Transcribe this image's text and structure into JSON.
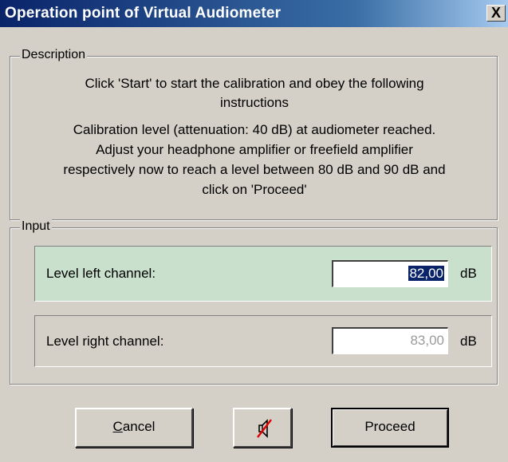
{
  "window": {
    "title": "Operation point of Virtual Audiometer",
    "close_label": "X"
  },
  "description": {
    "legend": "Description",
    "lines": [
      "Click 'Start' to start the calibration and obey the following",
      "instructions",
      "Calibration level (attenuation: 40 dB) at audiometer reached.",
      "Adjust your headphone amplifier or freefield amplifier",
      "respectively now to reach a level between 80 dB and 90 dB and",
      "click on 'Proceed'"
    ]
  },
  "input": {
    "legend": "Input",
    "left": {
      "label": "Level left channel:",
      "value": "82,00",
      "unit": "dB",
      "selected": true
    },
    "right": {
      "label": "Level right channel:",
      "value": "83,00",
      "unit": "dB",
      "disabled": true
    }
  },
  "buttons": {
    "cancel": {
      "mnemonic": "C",
      "rest": "ancel"
    },
    "mute_icon": "speaker-muted-icon",
    "proceed": "Proceed"
  },
  "colors": {
    "title_bar": "#0a246a",
    "active_row": "#c8e0cc",
    "selection": "#0a246a",
    "mute_cross": "#e00000"
  }
}
